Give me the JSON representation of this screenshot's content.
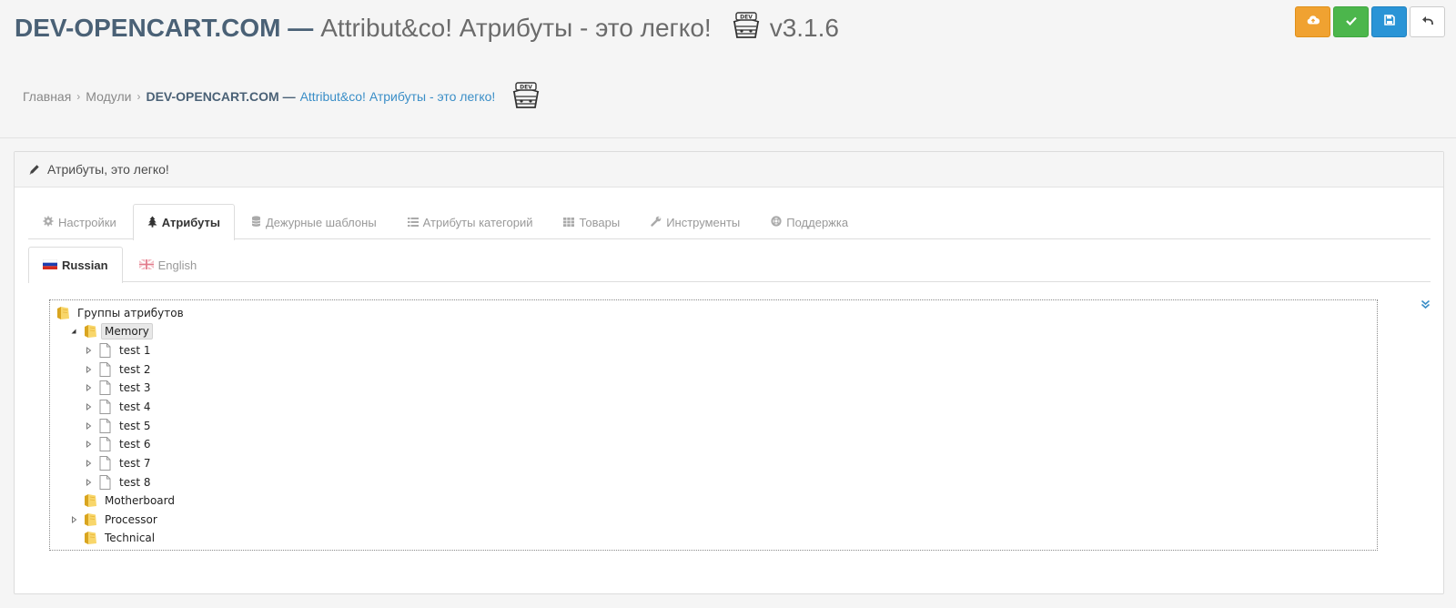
{
  "header": {
    "brand": "DEV-OPENCART.COM —",
    "subtitle": "Attribut&co! Атрибуты - это легко!",
    "version": "v3.1.6"
  },
  "toolbar": {
    "buttons": [
      {
        "icon": "cloud-upload-icon",
        "color": "#f0a231"
      },
      {
        "icon": "check-icon",
        "color": "#4cb64c"
      },
      {
        "icon": "save-icon",
        "color": "#2a94d6"
      },
      {
        "icon": "reply-icon",
        "color": "#ffffff"
      }
    ]
  },
  "breadcrumb": {
    "home": "Главная",
    "modules": "Модули",
    "brand": "DEV-OPENCART.COM —",
    "current": "Attribut&co! Атрибуты - это легко!"
  },
  "panel": {
    "title": "Атрибуты, это легко!"
  },
  "tabs": [
    {
      "label": "Настройки",
      "icon": "cog-icon",
      "active": false
    },
    {
      "label": "Атрибуты",
      "icon": "tree-icon",
      "active": true
    },
    {
      "label": "Дежурные шаблоны",
      "icon": "database-icon",
      "active": false
    },
    {
      "label": "Атрибуты категорий",
      "icon": "list-icon",
      "active": false
    },
    {
      "label": "Товары",
      "icon": "grid-icon",
      "active": false
    },
    {
      "label": "Инструменты",
      "icon": "wrench-icon",
      "active": false
    },
    {
      "label": "Поддержка",
      "icon": "lifebuoy-icon",
      "active": false
    }
  ],
  "languages": [
    {
      "label": "Russian",
      "icon": "flag-ru-icon",
      "active": true
    },
    {
      "label": "English",
      "icon": "flag-gb-icon",
      "active": false
    }
  ],
  "tree": {
    "root": "Группы атрибутов",
    "groups": [
      {
        "name": "Memory",
        "expanded": true,
        "selected": true,
        "items": [
          "test 1",
          "test 2",
          "test 3",
          "test 4",
          "test 5",
          "test 6",
          "test 7",
          "test 8"
        ]
      },
      {
        "name": "Motherboard",
        "expanded": false,
        "has_children": false
      },
      {
        "name": "Processor",
        "expanded": false,
        "has_children": true
      },
      {
        "name": "Technical",
        "expanded": false,
        "has_children": false
      }
    ]
  },
  "colors": {
    "brand": "#4a6176",
    "link": "#3a8ec7",
    "orange": "#f0a231",
    "green": "#4cb64c",
    "blue": "#2a94d6"
  }
}
